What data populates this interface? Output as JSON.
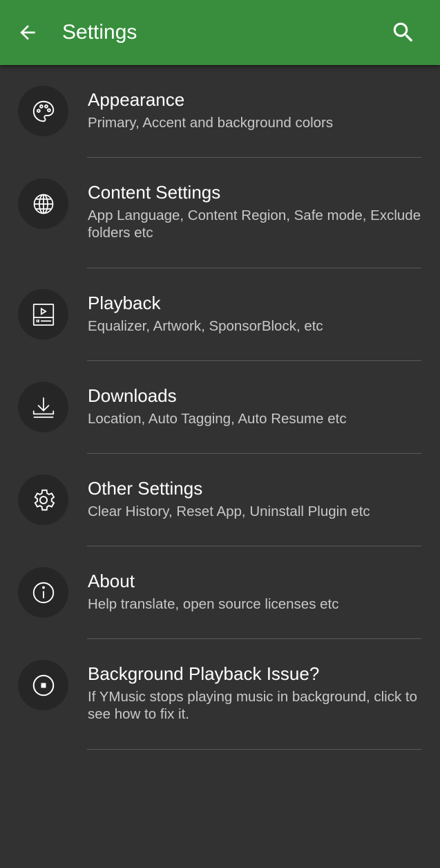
{
  "appbar": {
    "title": "Settings",
    "back_icon": "arrow-left-icon",
    "search_icon": "search-icon",
    "color": "#388e3c"
  },
  "settings": [
    {
      "title": "Appearance",
      "subtitle": "Primary, Accent and background colors",
      "icon": "palette-icon"
    },
    {
      "title": "Content Settings",
      "subtitle": "App Language, Content Region, Safe mode, Exclude folders etc",
      "icon": "globe-icon"
    },
    {
      "title": "Playback",
      "subtitle": "Equalizer, Artwork, SponsorBlock, etc",
      "icon": "playback-icon"
    },
    {
      "title": "Downloads",
      "subtitle": "Location, Auto Tagging, Auto Resume etc",
      "icon": "download-icon"
    },
    {
      "title": "Other Settings",
      "subtitle": "Clear History, Reset App, Uninstall Plugin etc",
      "icon": "gear-icon"
    },
    {
      "title": "About",
      "subtitle": "Help translate, open source licenses etc",
      "icon": "info-icon"
    },
    {
      "title": "Background Playback Issue?",
      "subtitle": "If YMusic stops playing music in background, click to see how to fix it.",
      "icon": "stop-circle-icon"
    }
  ]
}
